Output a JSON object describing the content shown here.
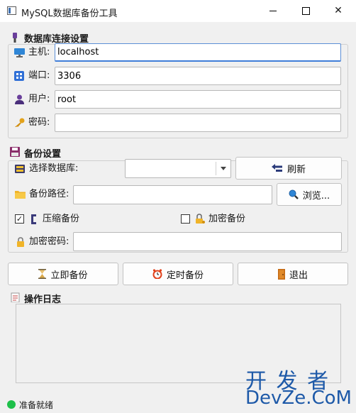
{
  "window": {
    "title": "MySQL数据库备份工具"
  },
  "connection": {
    "title": "数据库连接设置",
    "host_label": "主机:",
    "host_value": "localhost",
    "port_label": "端口:",
    "port_value": "3306",
    "user_label": "用户:",
    "user_value": "root",
    "password_label": "密码:",
    "password_value": ""
  },
  "backup": {
    "title": "备份设置",
    "db_label": "选择数据库:",
    "db_value": "",
    "refresh_label": "刷新",
    "path_label": "备份路径:",
    "path_value": "",
    "browse_label": "浏览...",
    "compress_label": "压缩备份",
    "compress_checked": true,
    "encrypt_label": "加密备份",
    "encrypt_checked": false,
    "encrypt_pwd_label": "加密密码:",
    "encrypt_pwd_value": ""
  },
  "actions": {
    "backup_now": "立即备份",
    "scheduled": "定时备份",
    "exit": "退出"
  },
  "log": {
    "title": "操作日志"
  },
  "status": {
    "text": "准备就绪",
    "color": "#1ec04a"
  },
  "watermark": {
    "line1": "开 发 者",
    "line2": "DevZe.CoM"
  }
}
